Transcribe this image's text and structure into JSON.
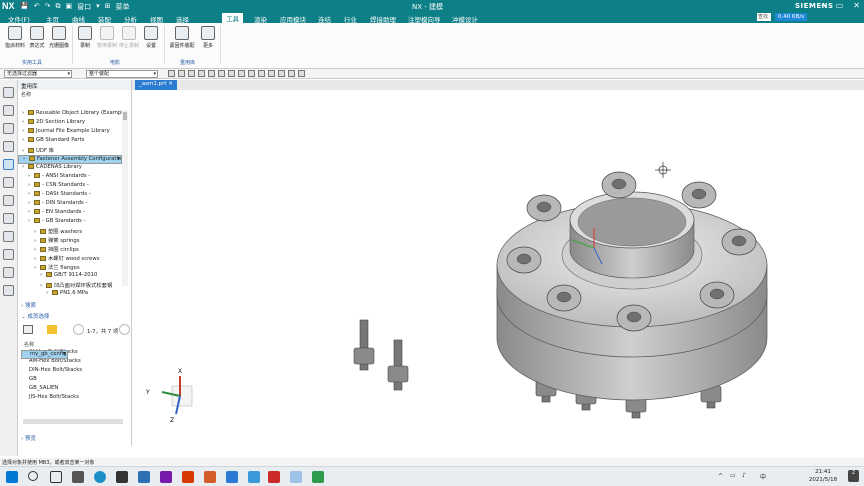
{
  "titlebar": {
    "app": "NX",
    "title": "NX - 建模",
    "brand": "SIEMENS",
    "quick_icons": [
      "💾",
      "↶",
      "↷",
      "⧉",
      "▣",
      "窗口",
      "▾",
      "⊞"
    ],
    "qa_label": "菜单",
    "window_controls": [
      "─",
      "▭",
      "✕"
    ]
  },
  "menu": {
    "items": [
      "文件(F)",
      "主页",
      "曲线",
      "装配",
      "分析",
      "视图",
      "选择",
      "工具",
      "渲染",
      "应用模块",
      "连结",
      "行业",
      "焊接助理",
      "注塑模向导",
      "冲模设计"
    ],
    "active": "工具",
    "find_placeholder": "查找",
    "network": "0.40 KB/s"
  },
  "ribbon": {
    "buttons": [
      {
        "label": "指派材料",
        "disabled": false
      },
      {
        "label": "表达式",
        "disabled": false
      },
      {
        "label": "光栅图像",
        "disabled": false
      },
      {
        "label": "录制",
        "disabled": false
      },
      {
        "label": "暂停录制",
        "disabled": true
      },
      {
        "label": "停止录制",
        "disabled": true
      },
      {
        "label": "设置",
        "disabled": false
      },
      {
        "label": "紧固件装配",
        "disabled": false
      },
      {
        "label": "更多",
        "disabled": false
      }
    ],
    "groups": [
      "实用工具",
      "电影",
      "重用库"
    ]
  },
  "selection_bar": {
    "filter": "无选择过滤器",
    "scope": "整个装配"
  },
  "document_tab": {
    "label": "_asm1.prt",
    "close": "✕"
  },
  "panel": {
    "title": "重用库",
    "column_header": "名称",
    "tree": [
      {
        "label": "Reusable Object Library (Example)",
        "indent": 0,
        "selected": false
      },
      {
        "label": "2D Section Library",
        "indent": 0,
        "selected": false
      },
      {
        "label": "Journal File Example Library",
        "indent": 0,
        "selected": false
      },
      {
        "label": "GB Standard Parts",
        "indent": 0,
        "selected": false
      },
      {
        "label": "UDF 库",
        "indent": 0,
        "selected": false
      },
      {
        "label": "Fastener Assembly Configuration",
        "indent": 0,
        "selected": true
      },
      {
        "label": "CADENAS Library",
        "indent": 0,
        "selected": false
      },
      {
        "label": "- ANSI Standards -",
        "indent": 1,
        "selected": false
      },
      {
        "label": "- CSN Standards -",
        "indent": 1,
        "selected": false
      },
      {
        "label": "- DASt Standards -",
        "indent": 1,
        "selected": false
      },
      {
        "label": "- DIN Standards -",
        "indent": 1,
        "selected": false
      },
      {
        "label": "- EN Standards -",
        "indent": 1,
        "selected": false
      },
      {
        "label": "- GB Standards -",
        "indent": 1,
        "selected": false
      },
      {
        "label": "垫圈 washers",
        "indent": 2,
        "selected": false
      },
      {
        "label": "弹簧 springs",
        "indent": 2,
        "selected": false
      },
      {
        "label": "挡圈 circlips",
        "indent": 2,
        "selected": false
      },
      {
        "label": "木螺钉 wood screws",
        "indent": 2,
        "selected": false
      },
      {
        "label": "法兰 flanges",
        "indent": 2,
        "selected": false
      },
      {
        "label": "GB/T 9114-2010",
        "indent": 3,
        "selected": false
      },
      {
        "label": "凹凸面对焊环板式松套钢",
        "indent": 3,
        "selected": false
      },
      {
        "label": "PN1.6 MPa",
        "indent": 4,
        "selected": false
      }
    ],
    "search_section": "搜索",
    "member_section": "成员选择",
    "pager": "1-7，共 7 项",
    "members_header": "名称",
    "members": [
      {
        "label": "AI-Hex Bolt/Stacks",
        "selected": false
      },
      {
        "label": "AM-Hex Bolt/Stacks",
        "selected": false
      },
      {
        "label": "DIN-Hex Bolt/Stacks",
        "selected": false
      },
      {
        "label": "GB",
        "selected": false
      },
      {
        "label": "GB_SALIEN",
        "selected": false
      },
      {
        "label": "JIS-Hex Bolt/Stacks",
        "selected": false
      },
      {
        "label": "my_gb_config",
        "selected": true
      }
    ],
    "preview_section": "预览"
  },
  "viewport": {
    "triad": {
      "x": "X",
      "y": "Y",
      "z": "Z"
    },
    "model": "flange assembly with 8 hex bolts"
  },
  "status": {
    "prompt": "选择对象并使用 MB3，或者双击某一对象"
  },
  "taskbar": {
    "time": "21:41",
    "date": "2021/5/18",
    "input": "中",
    "badge": "2"
  },
  "colors": {
    "accent": "#0d7f87",
    "selection": "#9ed2ee",
    "link": "#2b5fa8"
  }
}
